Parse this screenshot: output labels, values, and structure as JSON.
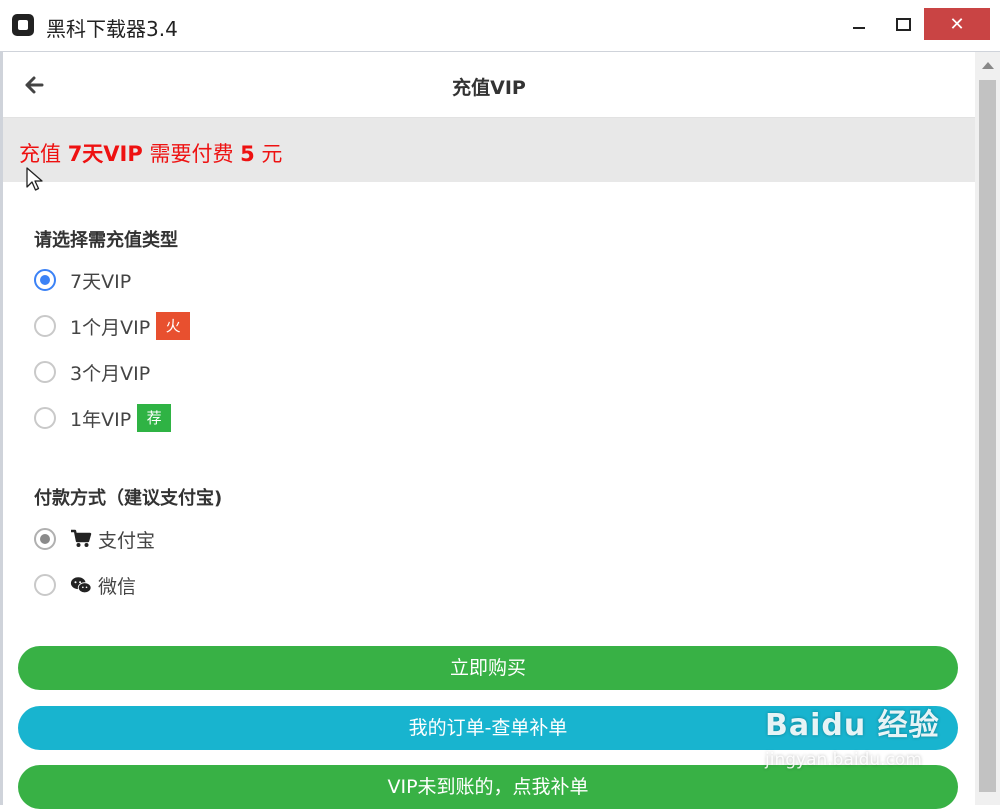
{
  "window": {
    "title": "黑科下载器3.4",
    "minimize_label": "",
    "maximize_label": "",
    "close_label": "✕"
  },
  "header": {
    "title": "充值VIP"
  },
  "notice": {
    "prefix": "充值 ",
    "plan": "7天VIP",
    "middle": " 需要付费 ",
    "amount": "5",
    "suffix": " 元"
  },
  "plan_section": {
    "title": "请选择需充值类型",
    "options": [
      {
        "label": "7天VIP",
        "selected": true,
        "tag": ""
      },
      {
        "label": "1个月VIP",
        "selected": false,
        "tag": "火"
      },
      {
        "label": "3个月VIP",
        "selected": false,
        "tag": ""
      },
      {
        "label": "1年VIP",
        "selected": false,
        "tag": "荐"
      }
    ]
  },
  "payment_section": {
    "title": "付款方式（建议支付宝)",
    "options": [
      {
        "label": "支付宝",
        "icon": "cart-icon",
        "selected": true
      },
      {
        "label": "微信",
        "icon": "wechat-icon",
        "selected": false
      }
    ]
  },
  "buttons": {
    "buy": "立即购买",
    "orders": "我的订单-查单补单",
    "supplement": "VIP未到账的，点我补单"
  },
  "watermark": {
    "logo": "Baidu 经验",
    "url": "jingyan.baidu.com"
  },
  "colors": {
    "accent_blue": "#3b82f6",
    "green": "#38b145",
    "cyan": "#18b4cf",
    "red_text": "#ee1111",
    "hot_tag": "#e8502f",
    "rec_tag": "#2fb344"
  }
}
